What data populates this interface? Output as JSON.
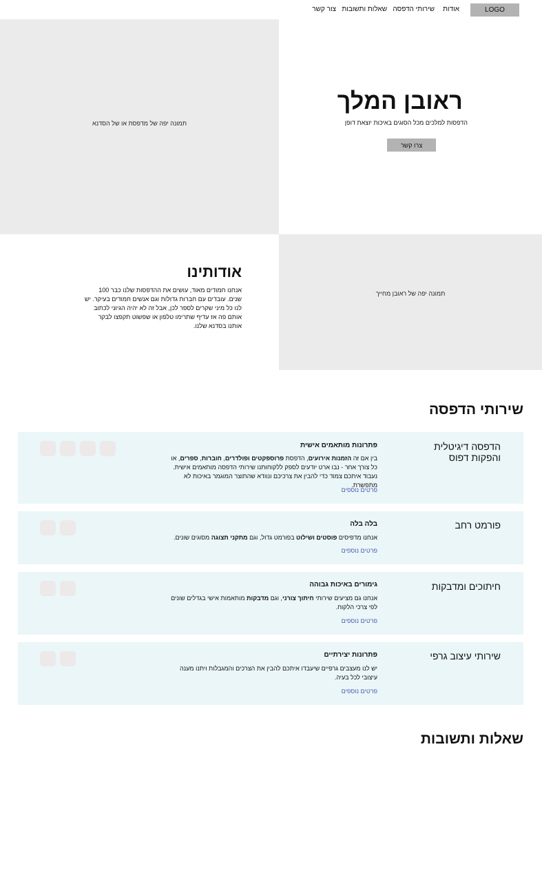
{
  "nav": {
    "logo": "LOGO",
    "links": [
      "אודות",
      "שירותי הדפסה",
      "שאלות ותשובות",
      "צור קשר"
    ]
  },
  "hero": {
    "image_caption": "תמונה יפה של מדפסת או של הסדנא",
    "title": "ראובן המלך",
    "subtitle": "הדפסות למלכים מכל הסוגים באיכות יוצאת דופן",
    "cta": "צרו קשר"
  },
  "about": {
    "title": "אודותינו",
    "body": "אנחנו חמודים מאוד, עושים את ההדפסות שלנו כבר 100 שנים. עובדים עם חברות גדולות וגם אנשים חמודים בעיקר. יש לנו כל מיני שקרים לספר לכן, אבל זה לא יהיה הגיוני לכתוב אותם פה אז עדיף שתרימו טלפון או שפשוט תקפצו לבקר אותנו בסדנא שלנו.",
    "image_caption": "תמונה יפה של ראובן מחייך"
  },
  "services": {
    "title": "שירותי הדפסה",
    "more_label": "פרטים נוספים",
    "items": [
      {
        "title": "הדפסה דיגיטלית והפקות דפוס",
        "subtitle": "פתרונות מותאמים אישית",
        "desc_parts": [
          {
            "t": "בין אם זה ",
            "b": false
          },
          {
            "t": "הזמנות אירועים",
            "b": true
          },
          {
            "t": ", הדפסת ",
            "b": false
          },
          {
            "t": "פרוספקטים ופולדרים",
            "b": true
          },
          {
            "t": ", ",
            "b": false
          },
          {
            "t": "חוברות",
            "b": true
          },
          {
            "t": ", ",
            "b": false
          },
          {
            "t": "ספרים",
            "b": true
          },
          {
            "t": ", או כל צורך אחר - נבו ארט יודעים לספק ללקוחותנו שירותי הדפסה מותאמים אישית. נעבוד איתכם צמוד כדי להבין את צרכיכם ונוודא שהתוצר המוגמר באיכות לא מתפשרת.",
            "b": false
          }
        ],
        "thumbs": 4
      },
      {
        "title": "פורמט רחב",
        "subtitle": "בלה בלה",
        "desc_parts": [
          {
            "t": "אנחנו מדפיסים ",
            "b": false
          },
          {
            "t": "פוסטים ושילוט",
            "b": true
          },
          {
            "t": " בפורמט גדול, וגם ",
            "b": false
          },
          {
            "t": "מתקני תצוגה",
            "b": true
          },
          {
            "t": " מסוגים שונים.",
            "b": false
          }
        ],
        "thumbs": 2
      },
      {
        "title": "חיתוכים ומדבקות",
        "subtitle": "גימורים באיכות גבוהה",
        "desc_parts": [
          {
            "t": "אנחנו גם מציעים שירותי ",
            "b": false
          },
          {
            "t": "חיתוך צורני",
            "b": true
          },
          {
            "t": ", וגם ",
            "b": false
          },
          {
            "t": "מדבקות",
            "b": true
          },
          {
            "t": " מותאמות אישי בגדלים שונים לפי צרכי הלקוח.",
            "b": false
          }
        ],
        "thumbs": 2
      },
      {
        "title": "שירותי עיצוב גרפי",
        "subtitle": "פתרונות יצירתיים",
        "desc_parts": [
          {
            "t": "יש לנו מעצבים גרפיים שיעבדו איתכם להבין את הצרכים והמגבלות ויתנו מענה עיצובי לכל בעיה.",
            "b": false
          }
        ],
        "thumbs": 2
      }
    ]
  },
  "faq": {
    "title": "שאלות ותשובות"
  },
  "colors": {
    "card_bg": "#eaf6f8",
    "placeholder_bg": "#ebebeb",
    "button_bg": "#b3b3b3",
    "link": "#4a5bb5"
  }
}
